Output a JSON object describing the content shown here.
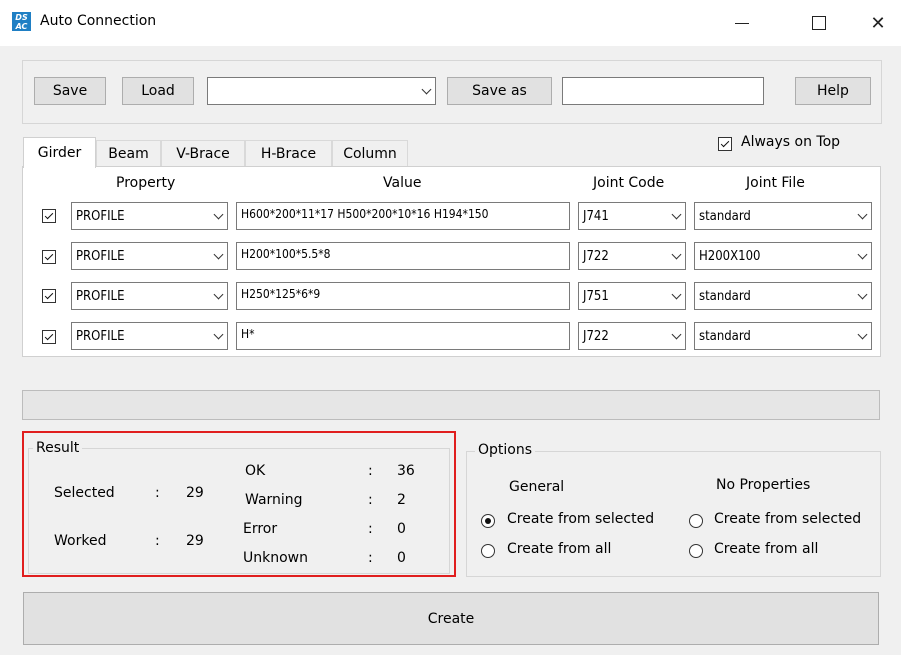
{
  "window": {
    "icon_text": "DS\nAC",
    "title": "Auto Connection"
  },
  "toolbar": {
    "save_label": "Save",
    "load_label": "Load",
    "file_combo_value": "",
    "save_as_label": "Save as",
    "save_as_value": "",
    "help_label": "Help"
  },
  "tabs": [
    {
      "label": "Girder",
      "active": true
    },
    {
      "label": "Beam",
      "active": false
    },
    {
      "label": "V-Brace",
      "active": false
    },
    {
      "label": "H-Brace",
      "active": false
    },
    {
      "label": "Column",
      "active": false
    }
  ],
  "always_on_top": {
    "label": "Always on Top",
    "checked": true
  },
  "table": {
    "headers": {
      "property": "Property",
      "value": "Value",
      "joint_code": "Joint Code",
      "joint_file": "Joint File"
    },
    "rows": [
      {
        "checked": true,
        "property": "PROFILE",
        "value": "H600*200*11*17 H500*200*10*16 H194*150",
        "joint_code": "J741",
        "joint_file": "standard"
      },
      {
        "checked": true,
        "property": "PROFILE",
        "value": "H200*100*5.5*8",
        "joint_code": "J722",
        "joint_file": "H200X100"
      },
      {
        "checked": true,
        "property": "PROFILE",
        "value": "H250*125*6*9",
        "joint_code": "J751",
        "joint_file": "standard"
      },
      {
        "checked": true,
        "property": "PROFILE",
        "value": "H*",
        "joint_code": "J722",
        "joint_file": "standard"
      }
    ]
  },
  "result": {
    "title": "Result",
    "colon": ":",
    "selected_label": "Selected",
    "selected_value": "29",
    "worked_label": "Worked",
    "worked_value": "29",
    "ok_label": "OK",
    "ok_value": "36",
    "warning_label": "Warning",
    "warning_value": "2",
    "error_label": "Error",
    "error_value": "0",
    "unknown_label": "Unknown",
    "unknown_value": "0"
  },
  "options": {
    "title": "Options",
    "general_label": "General",
    "no_properties_label": "No Properties",
    "general_from_selected": "Create from selected",
    "general_from_all": "Create from all",
    "noprop_from_selected": "Create from selected",
    "noprop_from_all": "Create from all",
    "general_choice": "selected",
    "noprop_choice": "none"
  },
  "create_label": "Create",
  "colors": {
    "highlight_border": "#e01e1e",
    "icon_bg": "#1f7fc4"
  }
}
